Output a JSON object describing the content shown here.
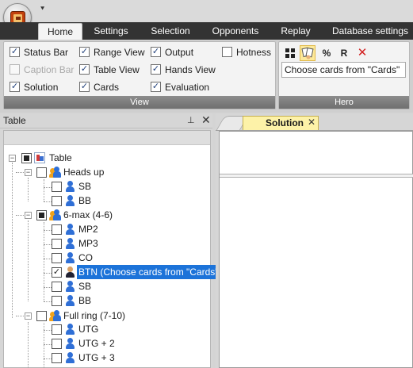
{
  "ribbon_tabs": [
    {
      "label": "Home",
      "active": true
    },
    {
      "label": "Settings"
    },
    {
      "label": "Selection"
    },
    {
      "label": "Opponents"
    },
    {
      "label": "Replay"
    },
    {
      "label": "Database settings"
    }
  ],
  "view_group": {
    "label": "View",
    "checkboxes": [
      {
        "label": "Status Bar",
        "checked": true,
        "enabled": true
      },
      {
        "label": "Caption Bar",
        "checked": false,
        "enabled": false
      },
      {
        "label": "Solution",
        "checked": true,
        "enabled": true
      },
      {
        "label": "Range View",
        "checked": true,
        "enabled": true
      },
      {
        "label": "Table View",
        "checked": true,
        "enabled": true
      },
      {
        "label": "Cards",
        "checked": true,
        "enabled": true
      },
      {
        "label": "Output",
        "checked": true,
        "enabled": true
      },
      {
        "label": "Hands View",
        "checked": true,
        "enabled": true
      },
      {
        "label": "Evaluation",
        "checked": true,
        "enabled": true
      },
      {
        "label": "Hotness",
        "checked": false,
        "enabled": true
      }
    ]
  },
  "hero_group": {
    "label": "Hero",
    "buttons": [
      {
        "icon": "cards-grid-icon",
        "label": ""
      },
      {
        "icon": "hand-cards-icon",
        "label": "",
        "selected": true
      },
      {
        "icon": "percent-icon",
        "label": "%"
      },
      {
        "icon": "range-icon",
        "label": "R"
      },
      {
        "icon": "delete-icon",
        "label": ""
      }
    ],
    "field_value": "Choose cards from \"Cards\""
  },
  "table_pane": {
    "title": "Table",
    "pin_glyph": "⊥",
    "close_glyph": "✕",
    "tree": [
      {
        "label": "Table"
      },
      {
        "label": "Heads up"
      },
      {
        "label": "SB"
      },
      {
        "label": "BB"
      },
      {
        "label": "6-max (4-6)"
      },
      {
        "label": "MP2"
      },
      {
        "label": "MP3"
      },
      {
        "label": "CO"
      },
      {
        "label": "BTN (Choose cards from \"Cards\")"
      },
      {
        "label": "SB"
      },
      {
        "label": "BB"
      },
      {
        "label": "Full ring (7-10)"
      },
      {
        "label": "UTG"
      },
      {
        "label": "UTG + 2"
      },
      {
        "label": "UTG + 3"
      }
    ]
  },
  "document": {
    "tab_label": "Solution",
    "close_glyph": "✕"
  },
  "glyphs": {
    "check": "✓",
    "minus": "−",
    "qat": "⯆",
    "delete": "✕"
  }
}
